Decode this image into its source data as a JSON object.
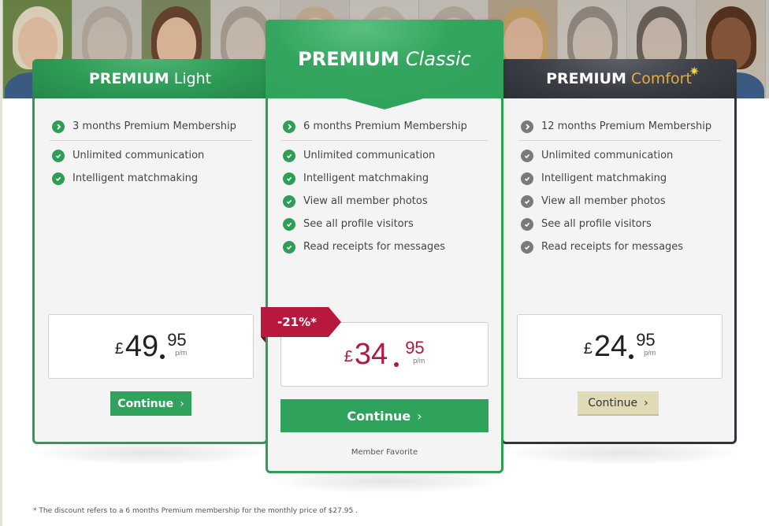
{
  "plans": [
    {
      "id": "light",
      "title_main": "PREMIUM",
      "title_sub": "Light",
      "duration": "3 months Premium Membership",
      "features": [
        "Unlimited communication",
        "Intelligent matchmaking"
      ],
      "price": {
        "currency": "£",
        "integer": "49",
        "decimal": "95",
        "unit": "p/m"
      },
      "button_label": "Continue",
      "accent": "#2fa35b"
    },
    {
      "id": "classic",
      "title_main": "PREMIUM",
      "title_sub": "Classic",
      "duration": "6 months Premium Membership",
      "features": [
        "Unlimited communication",
        "Intelligent matchmaking",
        "View all member photos",
        "See all profile visitors",
        "Read receipts for messages"
      ],
      "price": {
        "currency": "£",
        "integer": "34",
        "decimal": "95",
        "unit": "p/m"
      },
      "discount_badge": "-21%*",
      "button_label": "Continue",
      "tagline": "Member Favorite",
      "accent": "#2fa35b",
      "price_color": "#b4183e"
    },
    {
      "id": "comfort",
      "title_main": "PREMIUM",
      "title_sub": "Comfort",
      "duration": "12 months Premium Membership",
      "features": [
        "Unlimited communication",
        "Intelligent matchmaking",
        "View all member photos",
        "See all profile visitors",
        "Read receipts for messages"
      ],
      "price": {
        "currency": "£",
        "integer": "24",
        "decimal": "95",
        "unit": "p/m"
      },
      "button_label": "Continue",
      "accent": "#e2ad44"
    }
  ],
  "icons": {
    "duration": "chevron-right-circle-icon",
    "feature": "check-circle-icon",
    "button": "chevron-right-icon",
    "sparkle": "sparkle-icon"
  },
  "footnote": "* The discount refers to a 6 months Premium membership for the monthly price of $27.95 ."
}
